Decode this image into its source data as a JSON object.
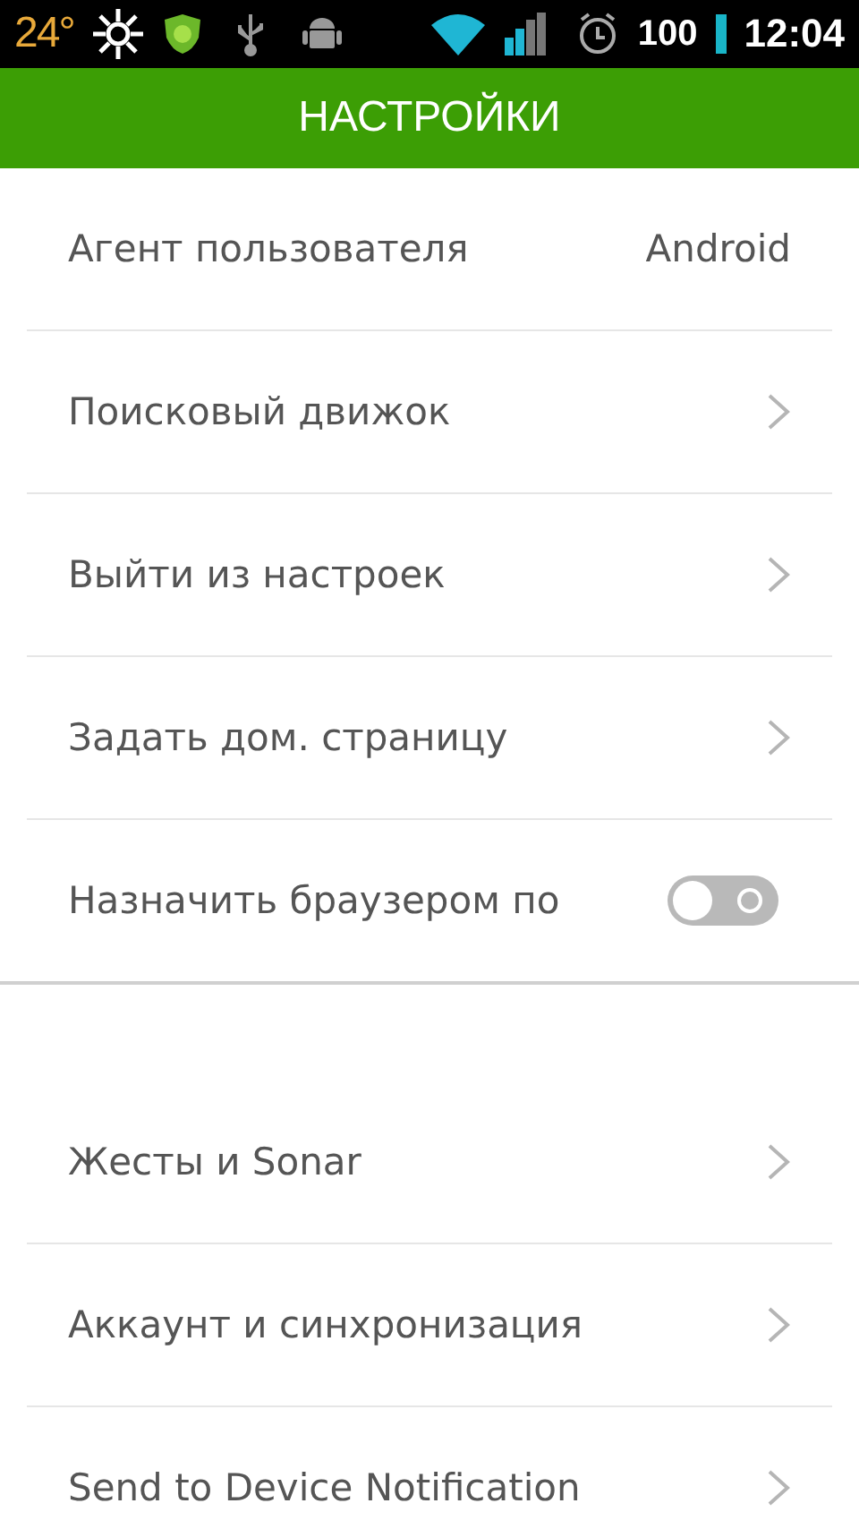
{
  "status_bar": {
    "temperature": "24°",
    "battery": "100",
    "time": "12:04"
  },
  "header": {
    "title": "НАСТРОЙКИ"
  },
  "sections": [
    {
      "items": [
        {
          "kind": "value",
          "label": "Агент пользователя",
          "value": "Android"
        },
        {
          "kind": "chevron",
          "label": "Поисковый движок"
        },
        {
          "kind": "chevron",
          "label": "Выйти из настроек"
        },
        {
          "kind": "chevron",
          "label": "Задать дом. страницу"
        },
        {
          "kind": "toggle",
          "label": "Назначить браузером по",
          "on": false
        }
      ]
    },
    {
      "items": [
        {
          "kind": "chevron",
          "label": "Жесты и Sonar"
        },
        {
          "kind": "chevron",
          "label": "Аккаунт и синхронизация"
        },
        {
          "kind": "chevron",
          "label": "Send to Device Notification"
        }
      ]
    }
  ]
}
